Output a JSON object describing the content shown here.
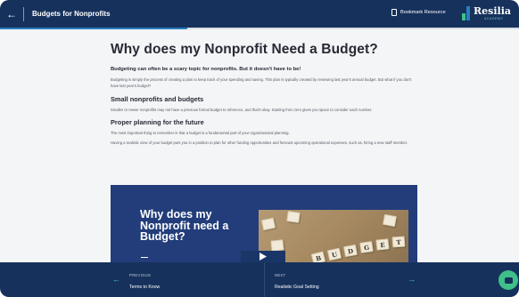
{
  "header": {
    "back_icon": "arrow-left-icon",
    "course_title": "Budgets for Nonprofits",
    "bookmark_icon": "bookmark-icon",
    "bookmark_label": "Bookmark Resource",
    "logo_name": "Resilia",
    "logo_sub": "ACADEMY"
  },
  "progress": {
    "percent": 36
  },
  "article": {
    "title": "Why does my Nonprofit Need a Budget?",
    "intro": "Budgeting can often be a scary topic for nonprofits. But it doesn't have to be!",
    "p1": "Budgeting is simply the process of creating a plan to keep track of your spending and saving. This plan is typically created by reviewing last year's annual budget. But what if you don't have last year's budget?",
    "h2_small": "Small nonprofits and budgets",
    "p2": "Smaller or newer nonprofits may not have a previous formal budget to reference, and that's okay. Starting from zero gives you space to consider each number.",
    "h2_planning": "Proper planning for the future",
    "p3": "The most important thing to remember is that a budget is a fundamental part of your organizational planning.",
    "p4": "Having a realistic view of your budget puts you in a position to plan for other funding opportunities and forecast upcoming operational expenses, such as, hiring a new staff member."
  },
  "video": {
    "title": "Why does my Nonprofit need a Budget?",
    "tiles": [
      "B",
      "U",
      "D",
      "G",
      "E",
      "T"
    ],
    "play_icon": "play-icon"
  },
  "footer": {
    "prev_kicker": "PREVIOUS",
    "prev_title": "Terms to Know",
    "prev_icon": "arrow-left-icon",
    "next_kicker": "NEXT",
    "next_title": "Realistic Goal Setting",
    "next_icon": "arrow-right-icon"
  },
  "chat": {
    "icon": "chat-icon"
  },
  "colors": {
    "navy": "#16315c",
    "accent_teal": "#4fc4b5",
    "chat_green": "#3fbf89",
    "progress_blue": "#2a7dbd"
  }
}
